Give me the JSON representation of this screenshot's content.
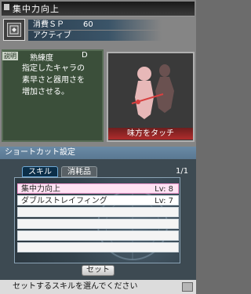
{
  "top": {
    "title": "集中力向上",
    "sp_label": "消費ＳＰ",
    "sp_value": "60",
    "type_label": "アクティブ",
    "desc_tab": "説明",
    "mastery_label": "熟練度",
    "mastery_value": "D",
    "description": "指定したキャラの\n素早さと器用さを\n増加させる。",
    "touch_ally": "味方をタッチ"
  },
  "bottom": {
    "header": "ショートカット設定",
    "tabs": [
      "スキル",
      "消耗品"
    ],
    "page": "1/1",
    "skills": [
      {
        "name": "集中力向上",
        "level": "Lv: 8"
      },
      {
        "name": "ダブルストレイフィング",
        "level": "Lv: 7"
      }
    ],
    "set_button": "セット",
    "hint": "セットするスキルを選んでください"
  },
  "colors": {
    "selected_row": "#ffe3f3",
    "touch_ally_bg": "#b02c2c",
    "header_bg": "#6a8aa6"
  }
}
